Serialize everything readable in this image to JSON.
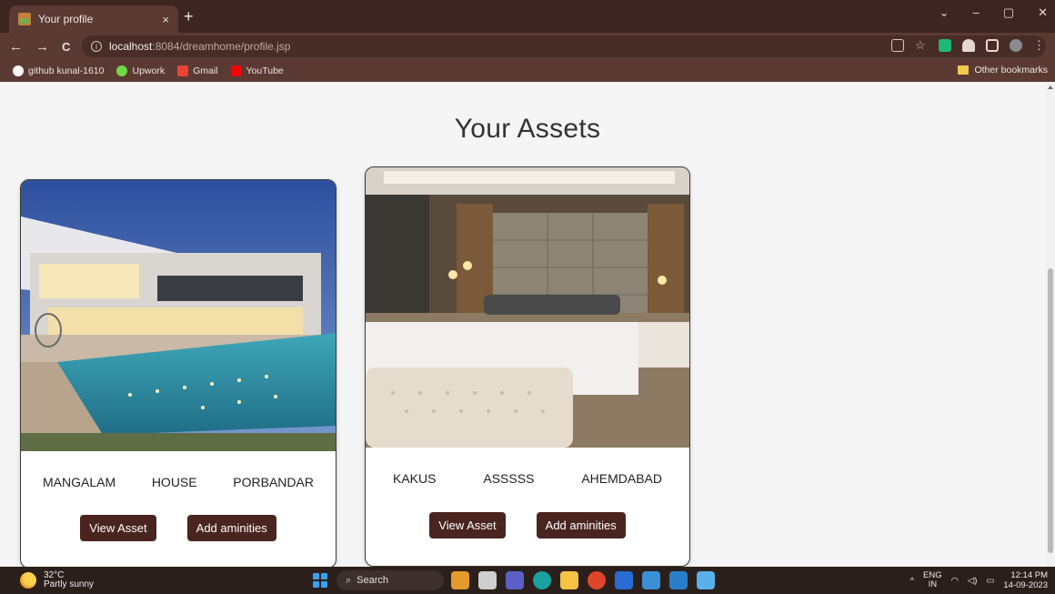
{
  "browser": {
    "tab": {
      "title": "Your profile",
      "close": "×"
    },
    "new_tab": "+",
    "window": {
      "minimize": "–",
      "maximize": "▢",
      "close": "✕",
      "dropdown": "⌄"
    },
    "nav": {
      "back": "←",
      "forward": "→",
      "reload": "C"
    },
    "url": {
      "host": "localhost",
      "path": ":8084/dreamhome/profile.jsp"
    },
    "bookmarks": [
      {
        "label": "github kunal-1610",
        "color": "#ffffff"
      },
      {
        "label": "Upwork",
        "color": "#6fda44"
      },
      {
        "label": "Gmail",
        "color": "#ea4335"
      },
      {
        "label": "YouTube",
        "color": "#ff0000"
      }
    ],
    "other_bookmarks": "Other bookmarks"
  },
  "page": {
    "title": "Your Assets",
    "assets": [
      {
        "name": "MANGALAM",
        "type": "HOUSE",
        "city": "PORBANDAR",
        "view_label": "View Asset",
        "add_label": "Add aminities"
      },
      {
        "name": "KAKUS",
        "type": "ASSSSS",
        "city": "AHEMDABAD",
        "view_label": "View Asset",
        "add_label": "Add aminities"
      }
    ]
  },
  "taskbar": {
    "weather": {
      "temp": "32°C",
      "condition": "Partly sunny"
    },
    "search_label": "Search",
    "lang_top": "ENG",
    "lang_bottom": "IN",
    "time": "12:14 PM",
    "date": "14-09-2023"
  },
  "colors": {
    "brand_dark": "#4a241f",
    "chrome_frame": "#3d2622",
    "chrome_toolbar": "#5a3a33"
  }
}
